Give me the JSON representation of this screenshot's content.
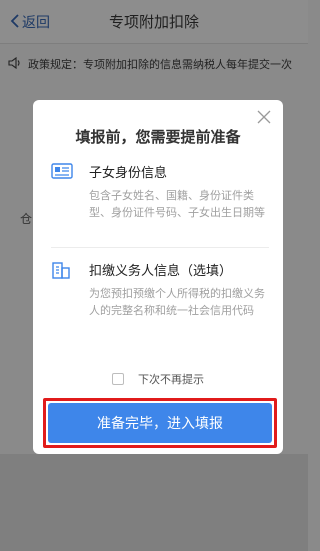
{
  "navbar": {
    "back_label": "返回",
    "back_icon": "chevron-left-icon",
    "title": "专项附加扣除"
  },
  "notice": {
    "icon": "speaker-icon",
    "text": "政策规定：专项附加扣除的信息需纳税人每年提交一次"
  },
  "background": {
    "partial_char": "仓"
  },
  "dialog": {
    "title": "填报前，您需要提前准备",
    "close_icon": "close-icon",
    "sections": [
      {
        "icon": "id-card-icon",
        "title": "子女身份信息",
        "desc": "包含子女姓名、国籍、身份证件类型、身份证件号码、子女出生日期等"
      },
      {
        "icon": "building-icon",
        "title": "扣缴义务人信息（选填）",
        "desc": "为您预扣预缴个人所得税的扣缴义务人的完整名称和统一社会信用代码"
      }
    ],
    "checkbox_label": "下次不再提示",
    "checkbox_checked": false,
    "confirm_button": "准备完毕，进入填报"
  },
  "colors": {
    "accent": "#3e86ea",
    "highlight": "#e11b1b",
    "icon_blue": "#3e86ea"
  }
}
